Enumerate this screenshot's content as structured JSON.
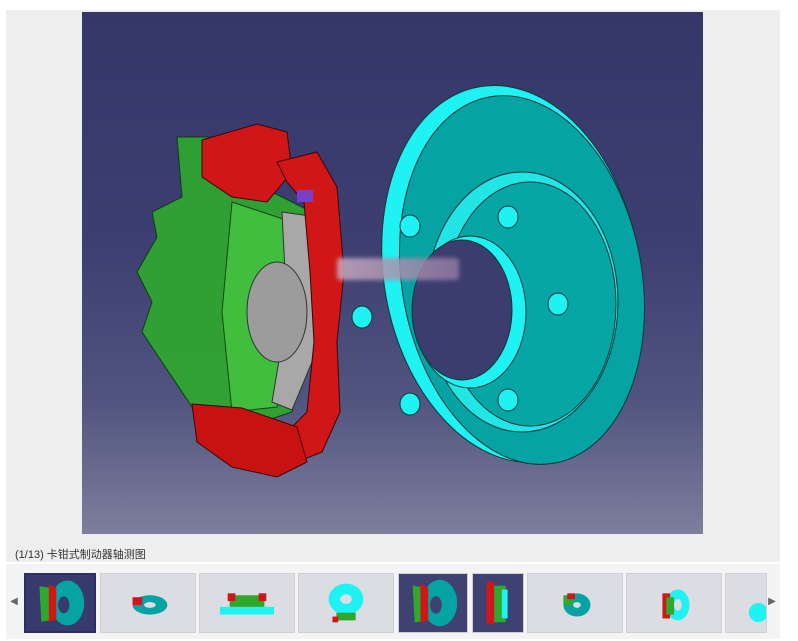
{
  "viewer": {
    "caption": "(1/13) 卡钳式制动器轴测图",
    "current_index": 1,
    "total": 13
  },
  "colors": {
    "background": "#3d3f72",
    "disc": "#05a3a3",
    "disc_edge": "#1ef2f2",
    "caliper": "#d01616",
    "housing": "#2fa82f",
    "pad": "#a8a8a8"
  },
  "thumbnails": [
    {
      "name": "thumb-1",
      "style": "caliper-side",
      "active": true
    },
    {
      "name": "thumb-2",
      "style": "disc-tilt"
    },
    {
      "name": "thumb-3",
      "style": "assembly-flat"
    },
    {
      "name": "thumb-4",
      "style": "disc-front"
    },
    {
      "name": "thumb-5",
      "style": "caliper-side",
      "dark": true
    },
    {
      "name": "thumb-6",
      "style": "caliper-only",
      "dark": true
    },
    {
      "name": "thumb-7",
      "style": "disc-tilt"
    },
    {
      "name": "thumb-8",
      "style": "disc-side"
    },
    {
      "name": "thumb-9",
      "style": "partial"
    }
  ],
  "icons": {
    "prev": "chevron-left-icon",
    "next": "chevron-right-icon"
  }
}
